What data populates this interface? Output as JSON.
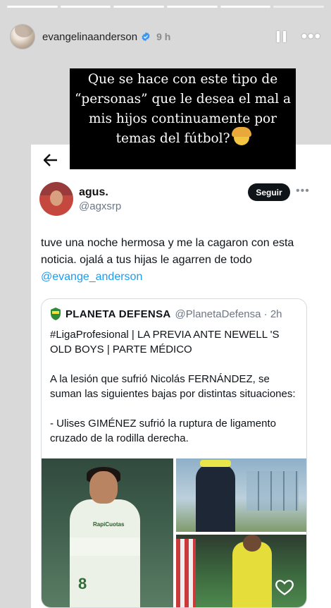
{
  "story": {
    "progress_segments": 6,
    "active_segment": 5,
    "username": "evangelinaanderson",
    "time": "9 h",
    "caption": "Que se hace con este tipo de “personas” que le desea el mal a mis hijos continuamente por temas del fútbol?"
  },
  "tweet": {
    "name": "agus.",
    "handle": "@agxsrp",
    "follow_label": "Seguir",
    "text": "tuve una noche hermosa y me la cagaron con esta noticia. ojalá a tus hijas le agarren de todo",
    "mention": "@evange_anderson"
  },
  "quote": {
    "name": "PLANETA DEFENSA",
    "handle": "@PlanetaDefensa · 2h",
    "para1": "#LigaProfesional | LA PREVIA ANTE NEWELL 'S OLD BOYS | PARTE MÉDICO",
    "para2": "A la lesión que sufrió Nicolás FERNÁNDEZ, se suman las siguientes bajas por distintas situaciones:",
    "para3": "- Ulises GIMÉNEZ sufrió la ruptura de ligamento cruzado de la rodilla derecha.",
    "sponsor": "RapiCuotas",
    "jersey_number": "8"
  },
  "icons": {
    "verified": "verified-badge-icon",
    "pause": "pause-icon",
    "more": "more-icon",
    "back": "back-arrow-icon",
    "heart": "heart-icon",
    "send": "send-icon"
  }
}
